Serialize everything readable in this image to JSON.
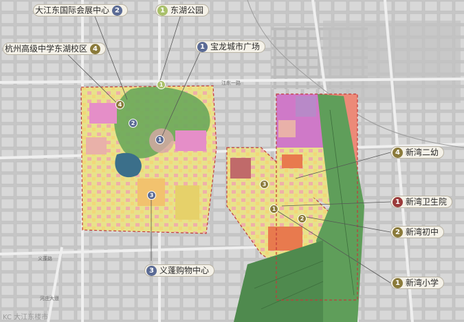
{
  "colors": {
    "purple_badge": "#5b6b95",
    "olive_badge": "#8a7a3a",
    "red_badge": "#9a3a3a",
    "green_badge": "#a9c06a"
  },
  "callouts": [
    {
      "id": "dajiangdong",
      "num": "2",
      "label": "大江东国际会展中心",
      "badge": "purple_badge"
    },
    {
      "id": "donghu-park",
      "num": "1",
      "label": "东湖公园",
      "badge": "green_badge"
    },
    {
      "id": "hangzhou-high",
      "num": "4",
      "label": "杭州高级中学东湖校区",
      "badge": "olive_badge"
    },
    {
      "id": "baolong",
      "num": "1",
      "label": "宝龙城市广场",
      "badge": "purple_badge"
    },
    {
      "id": "xinwan-kinder",
      "num": "4",
      "label": "新湾二幼",
      "badge": "olive_badge"
    },
    {
      "id": "xinwan-health",
      "num": "1",
      "label": "新湾卫生院",
      "badge": "red_badge"
    },
    {
      "id": "xinwan-middle",
      "num": "2",
      "label": "新湾初中",
      "badge": "olive_badge"
    },
    {
      "id": "yifeng",
      "num": "3",
      "label": "义蓬购物中心",
      "badge": "purple_badge"
    },
    {
      "id": "xinwan-primary",
      "num": "1",
      "label": "新湾小学",
      "badge": "olive_badge"
    }
  ],
  "markers": [
    {
      "num": "4"
    },
    {
      "num": "2"
    },
    {
      "num": "1"
    },
    {
      "num": "1"
    },
    {
      "num": "3"
    },
    {
      "num": "3"
    },
    {
      "num": "1"
    },
    {
      "num": "2"
    }
  ],
  "road_labels": [
    "江东一路",
    "义蓬路",
    "河庄大道"
  ],
  "watermark": "KC 大江东楼市"
}
